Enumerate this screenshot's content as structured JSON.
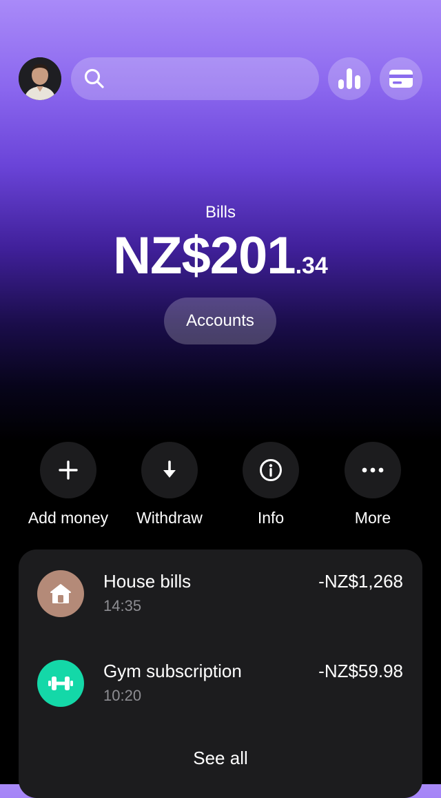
{
  "header": {
    "avatar_alt": "User avatar",
    "search": {
      "placeholder": "",
      "value": ""
    },
    "icons": {
      "search": "search-icon",
      "stats": "bar-chart-icon",
      "cards": "credit-card-icon"
    }
  },
  "account": {
    "name": "Bills",
    "balance_main": "NZ$201",
    "balance_cents": ".34",
    "accounts_button": "Accounts"
  },
  "actions": [
    {
      "label": "Add money",
      "icon": "plus-icon"
    },
    {
      "label": "Withdraw",
      "icon": "arrow-down-icon"
    },
    {
      "label": "Info",
      "icon": "info-icon"
    },
    {
      "label": "More",
      "icon": "more-dots-icon"
    }
  ],
  "transactions": {
    "items": [
      {
        "title": "House bills",
        "time": "14:35",
        "amount": "-NZ$1,268",
        "icon": "house-icon",
        "icon_bg": "#b48a78"
      },
      {
        "title": "Gym subscription",
        "time": "10:20",
        "amount": "-NZ$59.98",
        "icon": "dumbbell-icon",
        "icon_bg": "#14d8a8"
      }
    ],
    "see_all": "See all"
  },
  "colors": {
    "gradient_top": "#a98af8",
    "gradient_mid": "#6a44d8",
    "background": "#000000",
    "card": "#1c1c1e",
    "muted_text": "#8e8e93"
  }
}
